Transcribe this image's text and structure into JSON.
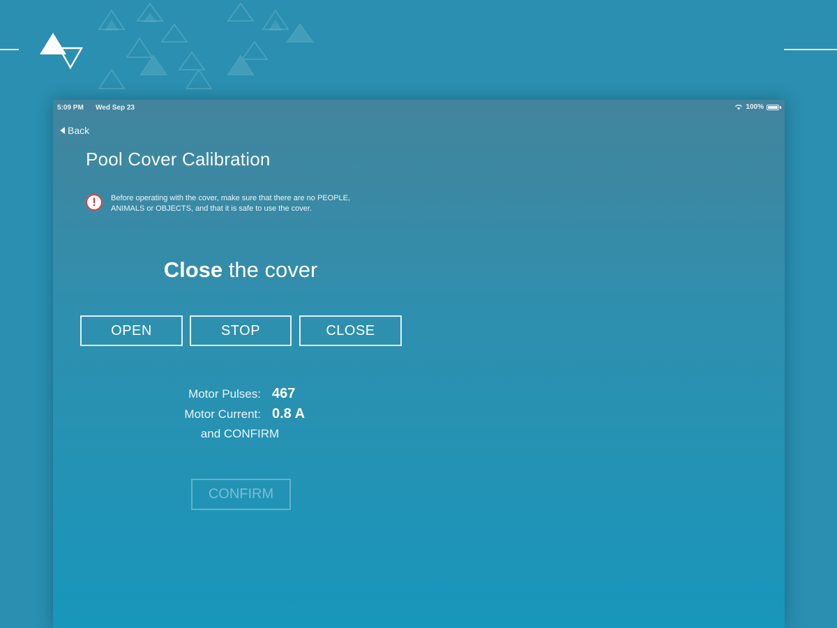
{
  "status_bar": {
    "time": "5:09 PM",
    "date": "Wed Sep 23",
    "battery": "100%",
    "wifi_icon": "wifi-icon",
    "battery_icon": "battery-icon"
  },
  "nav": {
    "back_label": "Back",
    "back_icon": "chevron-left-icon"
  },
  "page": {
    "title": "Pool Cover Calibration"
  },
  "warning": {
    "icon": "exclamation-circle-icon",
    "text": "Before operating with the cover, make sure that there  are no PEOPLE, ANIMALS or OBJECTS, and that it is safe to use the cover."
  },
  "instruction": {
    "bold": "Close",
    "rest": " the cover"
  },
  "controls": {
    "open_label": "OPEN",
    "stop_label": "STOP",
    "close_label": "CLOSE"
  },
  "metrics": {
    "pulses_label": "Motor Pulses:",
    "pulses_value": "467",
    "current_label": "Motor Current:",
    "current_value": "0.8 A",
    "confirm_hint": "and CONFIRM"
  },
  "confirm": {
    "label": "CONFIRM",
    "enabled": false
  },
  "colors": {
    "background": "#2a8fb0",
    "warning_red": "#d9363e",
    "text": "#ffffff"
  },
  "brand": {
    "logo_icon": "triangle-logo-icon"
  }
}
